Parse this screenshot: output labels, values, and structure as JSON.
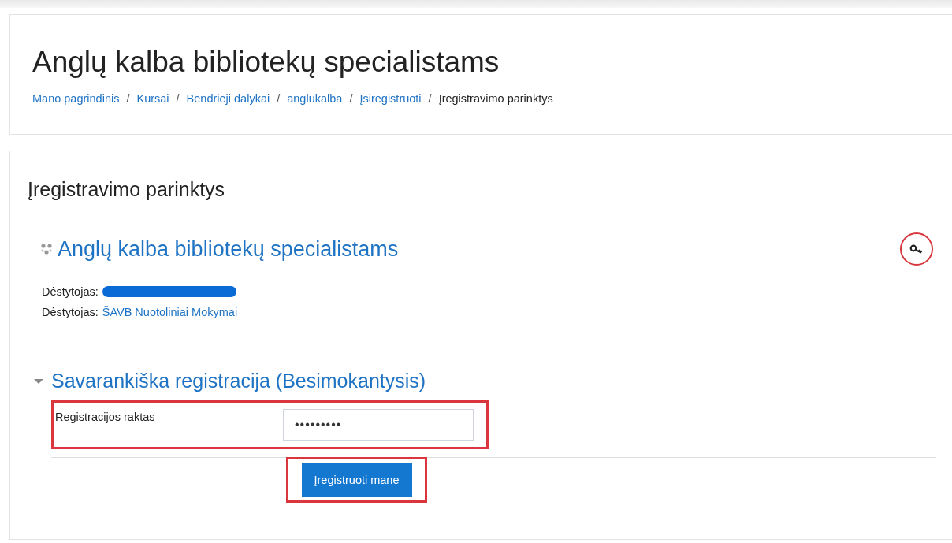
{
  "page_title": "Anglų kalba bibliotekų specialistams",
  "breadcrumb": [
    {
      "label": "Mano pagrindinis",
      "link": true
    },
    {
      "label": "Kursai",
      "link": true
    },
    {
      "label": "Bendrieji dalykai",
      "link": true
    },
    {
      "label": "anglukalba",
      "link": true
    },
    {
      "label": "Įsiregistruoti",
      "link": true
    },
    {
      "label": "Įregistravimo parinktys",
      "link": false
    }
  ],
  "separator": "/",
  "heading": "Įregistravimo parinktys",
  "course": {
    "title": "Anglų kalba bibliotekų specialistams",
    "key_highlighted": true,
    "teachers": [
      {
        "role": "Dėstytojas:",
        "kind": "redacted"
      },
      {
        "role": "Dėstytojas:",
        "kind": "link",
        "name": "ŠAVB Nuotoliniai Mokymai"
      }
    ]
  },
  "enrolment": {
    "title": "Savarankiška registracija (Besimokantysis)",
    "expanded": true,
    "field": {
      "label": "Registracijos raktas",
      "value": "•••••••••",
      "highlighted": true
    },
    "button": {
      "label": "Įregistruoti mane",
      "highlighted": true
    }
  }
}
